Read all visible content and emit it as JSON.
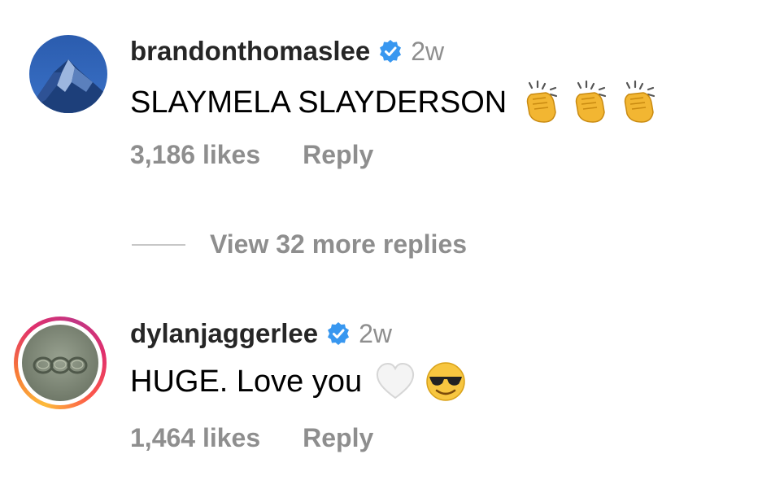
{
  "comments": [
    {
      "username": "brandonthomaslee",
      "time": "2w",
      "text": "SLAYMELA SLAYDERSON",
      "emojis": [
        "clapping-hands",
        "clapping-hands",
        "clapping-hands"
      ],
      "likes": "3,186 likes",
      "reply": "Reply"
    },
    {
      "username": "dylanjaggerlee",
      "time": "2w",
      "text": "HUGE. Love you",
      "emojis": [
        "white-heart",
        "sunglasses-face"
      ],
      "likes": "1,464 likes",
      "reply": "Reply"
    }
  ],
  "thread": {
    "view_replies": "View 32 more replies"
  },
  "colors": {
    "verified": "#3897f0",
    "muted": "#8e8e8e"
  }
}
